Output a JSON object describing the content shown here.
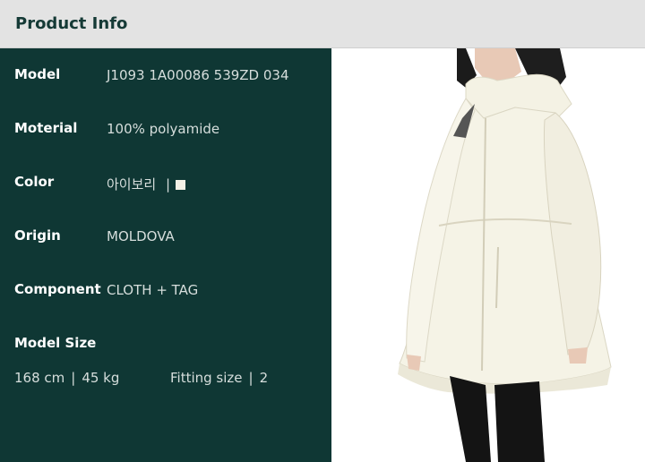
{
  "header": {
    "title": "Product Info"
  },
  "info": {
    "model_label": "Model",
    "model_value": "J1093 1A00086 539ZD 034",
    "material_label": "Moterial",
    "material_value": "100% polyamide",
    "color_label": "Color",
    "color_value": "아이보리",
    "color_divider": "|",
    "color_swatch": "#f4f1e6",
    "origin_label": "Origin",
    "origin_value": "MOLDOVA",
    "component_label": "Component",
    "component_value": "CLOTH + TAG",
    "model_size_label": "Model Size",
    "height": "168 cm",
    "divider": "|",
    "weight": "45 kg",
    "fitting_label": "Fitting size",
    "fitting_value": "2"
  },
  "colors": {
    "header_bg": "#e3e3e3",
    "panel_bg": "#0f3734",
    "accent_text": "#153a36"
  }
}
